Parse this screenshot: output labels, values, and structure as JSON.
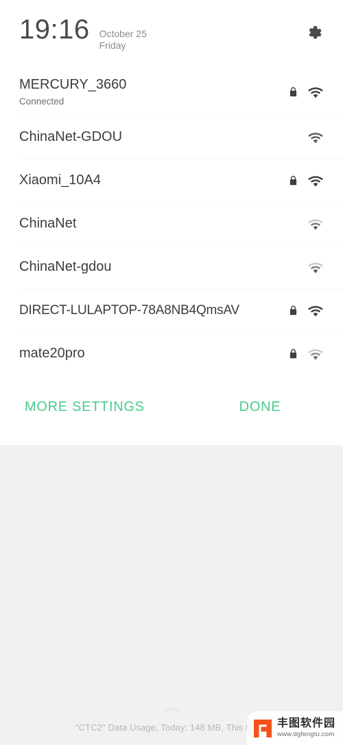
{
  "theme": {
    "accent_green": "#4ACB8B",
    "panel_background": "#ffffff",
    "page_background": "#f1f1f1",
    "primary_text": "#3c3c3c",
    "secondary_text": "#8a8a8a",
    "icon_dark": "#3f3f3f",
    "watermark_orange": "#F4511E"
  },
  "header": {
    "time": "19:16",
    "date": "October 25",
    "weekday": "Friday",
    "settings_icon": "gear-icon"
  },
  "network_list": [
    {
      "ssid": "MERCURY_3660",
      "status": "Connected",
      "secured": true,
      "lock_icon": "lock-icon",
      "wifi_icon": "wifi-icon",
      "signal_bars": 3,
      "signal_strength": "strong"
    },
    {
      "ssid": "ChinaNet-GDOU",
      "status": "",
      "secured": false,
      "lock_icon": "",
      "wifi_icon": "wifi-icon",
      "signal_bars": 2,
      "signal_strength": "medium"
    },
    {
      "ssid": "Xiaomi_10A4",
      "status": "",
      "secured": true,
      "lock_icon": "lock-icon",
      "wifi_icon": "wifi-icon",
      "signal_bars": 3,
      "signal_strength": "strong"
    },
    {
      "ssid": "ChinaNet",
      "status": "",
      "secured": false,
      "lock_icon": "",
      "wifi_icon": "wifi-icon",
      "signal_bars": 2,
      "signal_strength": "weak"
    },
    {
      "ssid": "ChinaNet-gdou",
      "status": "",
      "secured": false,
      "lock_icon": "",
      "wifi_icon": "wifi-icon",
      "signal_bars": 2,
      "signal_strength": "weak"
    },
    {
      "ssid": "DIRECT-LULAPTOP-78A8NB4QmsAV",
      "status": "",
      "secured": true,
      "lock_icon": "lock-icon",
      "wifi_icon": "wifi-icon",
      "signal_bars": 3,
      "signal_strength": "strong"
    },
    {
      "ssid": "mate20pro",
      "status": "",
      "secured": true,
      "lock_icon": "lock-icon",
      "wifi_icon": "wifi-icon",
      "signal_bars": 2,
      "signal_strength": "weak"
    }
  ],
  "actions": {
    "more_settings_label": "MORE SETTINGS",
    "done_label": "DONE"
  },
  "bottom_bar": {
    "status_text": "\"CTC2\" Data Usage, Today: 148 MB, This Mont'",
    "home_indicator": "home-indicator-icon"
  },
  "watermark": {
    "title": "丰图软件园",
    "url": "www.dgfengtu.com",
    "logo_icon": "fengtu-logo-icon"
  }
}
